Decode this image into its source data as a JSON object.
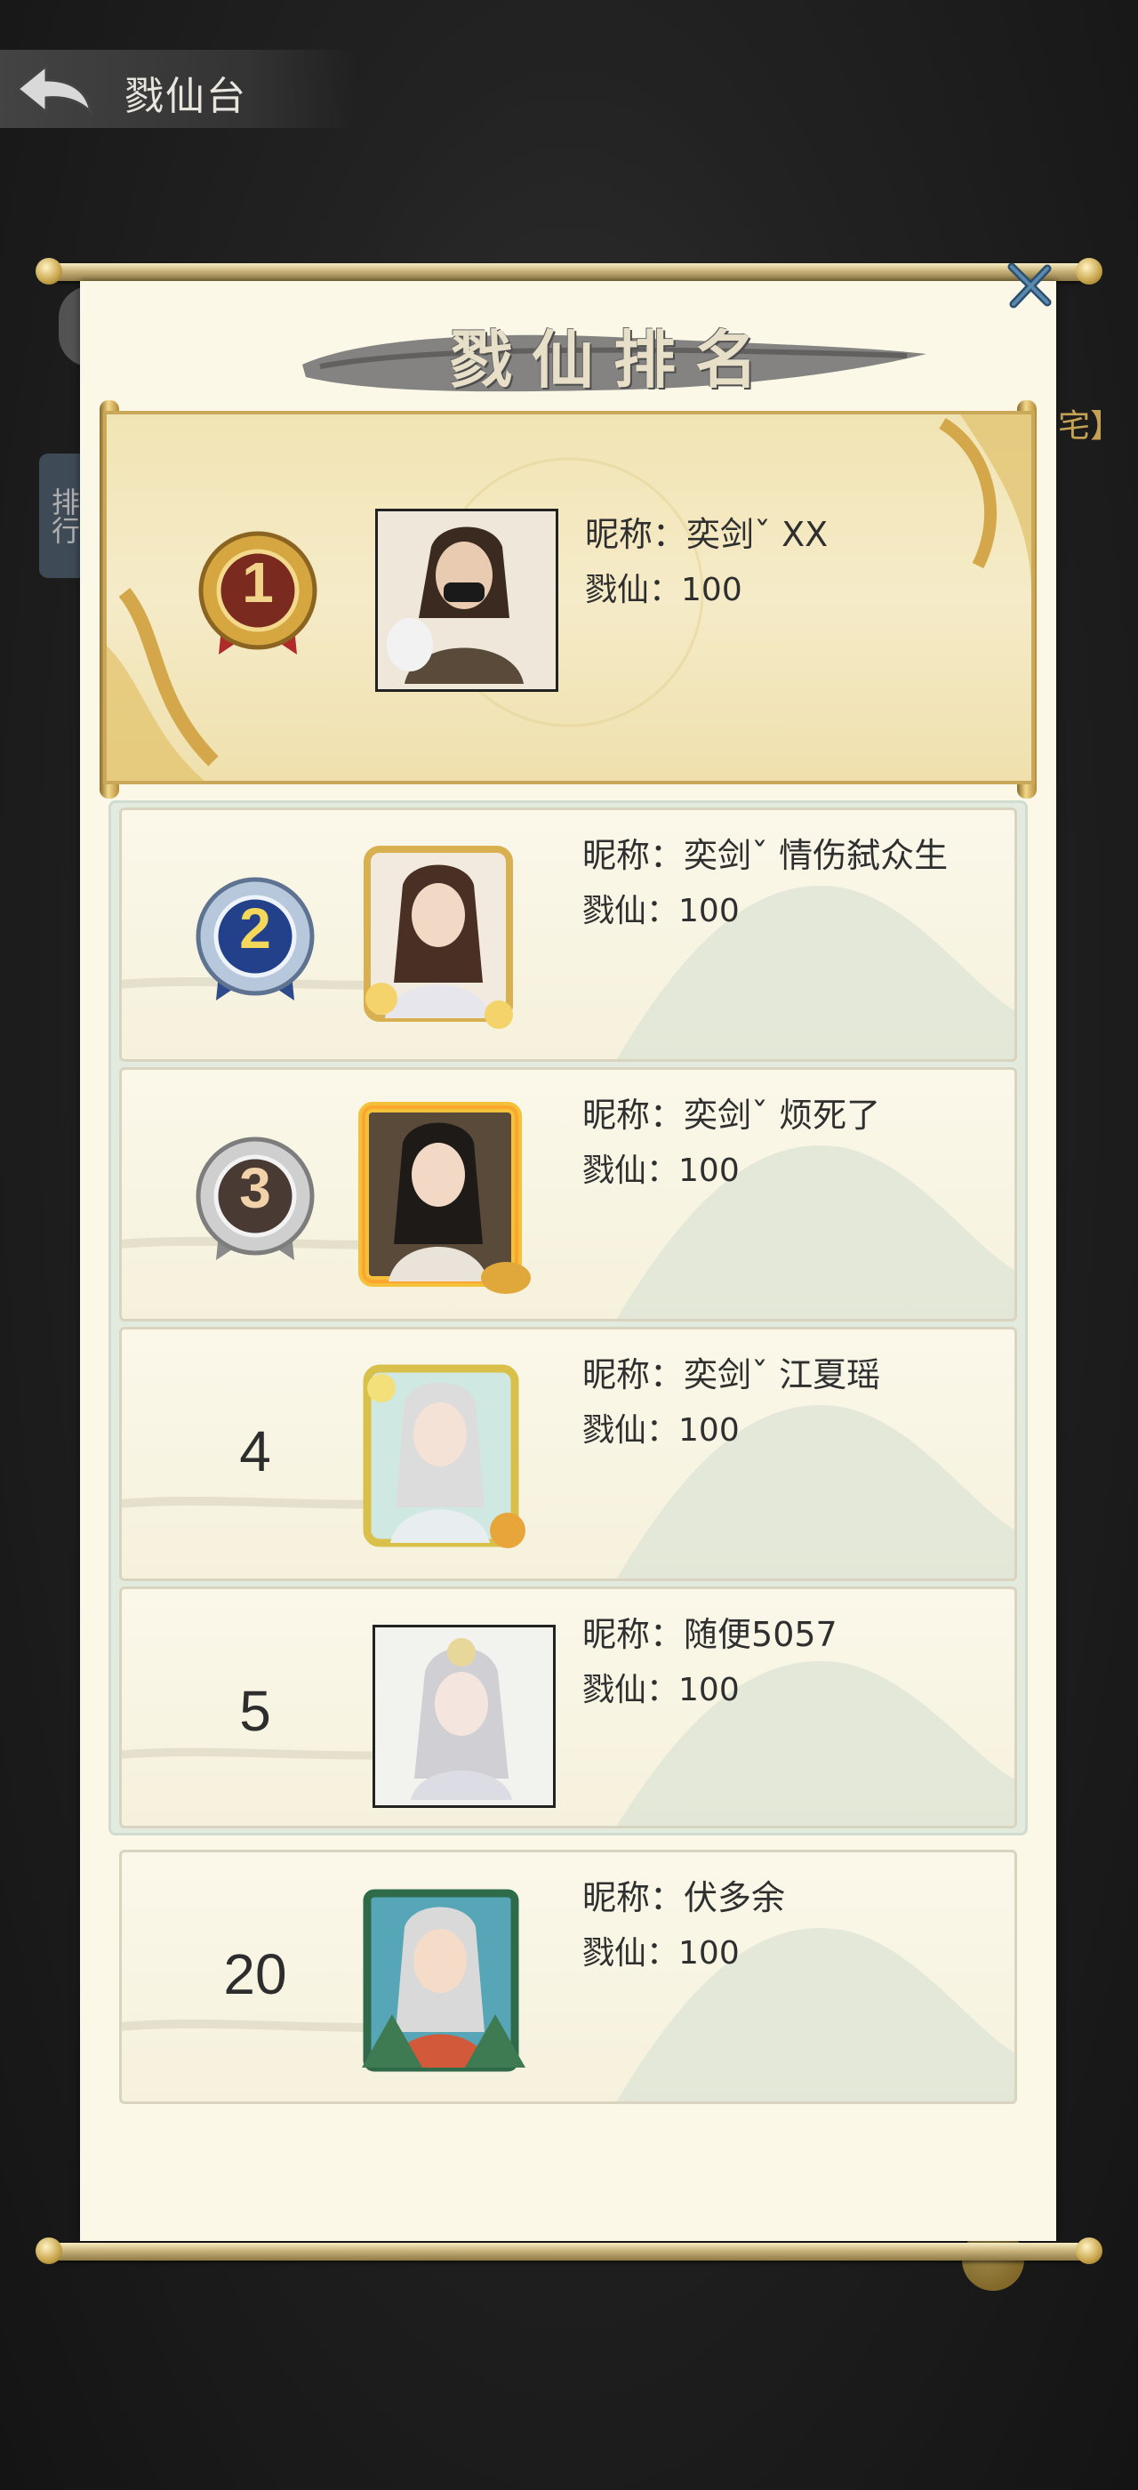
{
  "topbar": {
    "title": "戮仙台"
  },
  "background": {
    "tab_hint": "排行",
    "right_hint": "宅】"
  },
  "panel": {
    "title": "戮仙排名"
  },
  "labels": {
    "nickname_prefix": "昵称：",
    "score_prefix": "戮仙："
  },
  "rankings": [
    {
      "rank": "1",
      "name": "奕剑ˇ XX",
      "score": "100",
      "badge": "gold-medal-icon"
    },
    {
      "rank": "2",
      "name": "奕剑ˇ 情伤弑众生",
      "score": "100",
      "badge": "silver-medal-icon"
    },
    {
      "rank": "3",
      "name": "奕剑ˇ 烦死了",
      "score": "100",
      "badge": "bronze-medal-icon"
    },
    {
      "rank": "4",
      "name": "奕剑ˇ 江夏瑶",
      "score": "100"
    },
    {
      "rank": "5",
      "name": "随便5057",
      "score": "100"
    }
  ],
  "my_rank": {
    "rank": "20",
    "name": "伏多余",
    "score": "100"
  },
  "colors": {
    "panel_bg": "#fbf8e7",
    "gold": "#d4a84a",
    "row_border": "#d8d4c0",
    "text": "#2f2f2f"
  }
}
